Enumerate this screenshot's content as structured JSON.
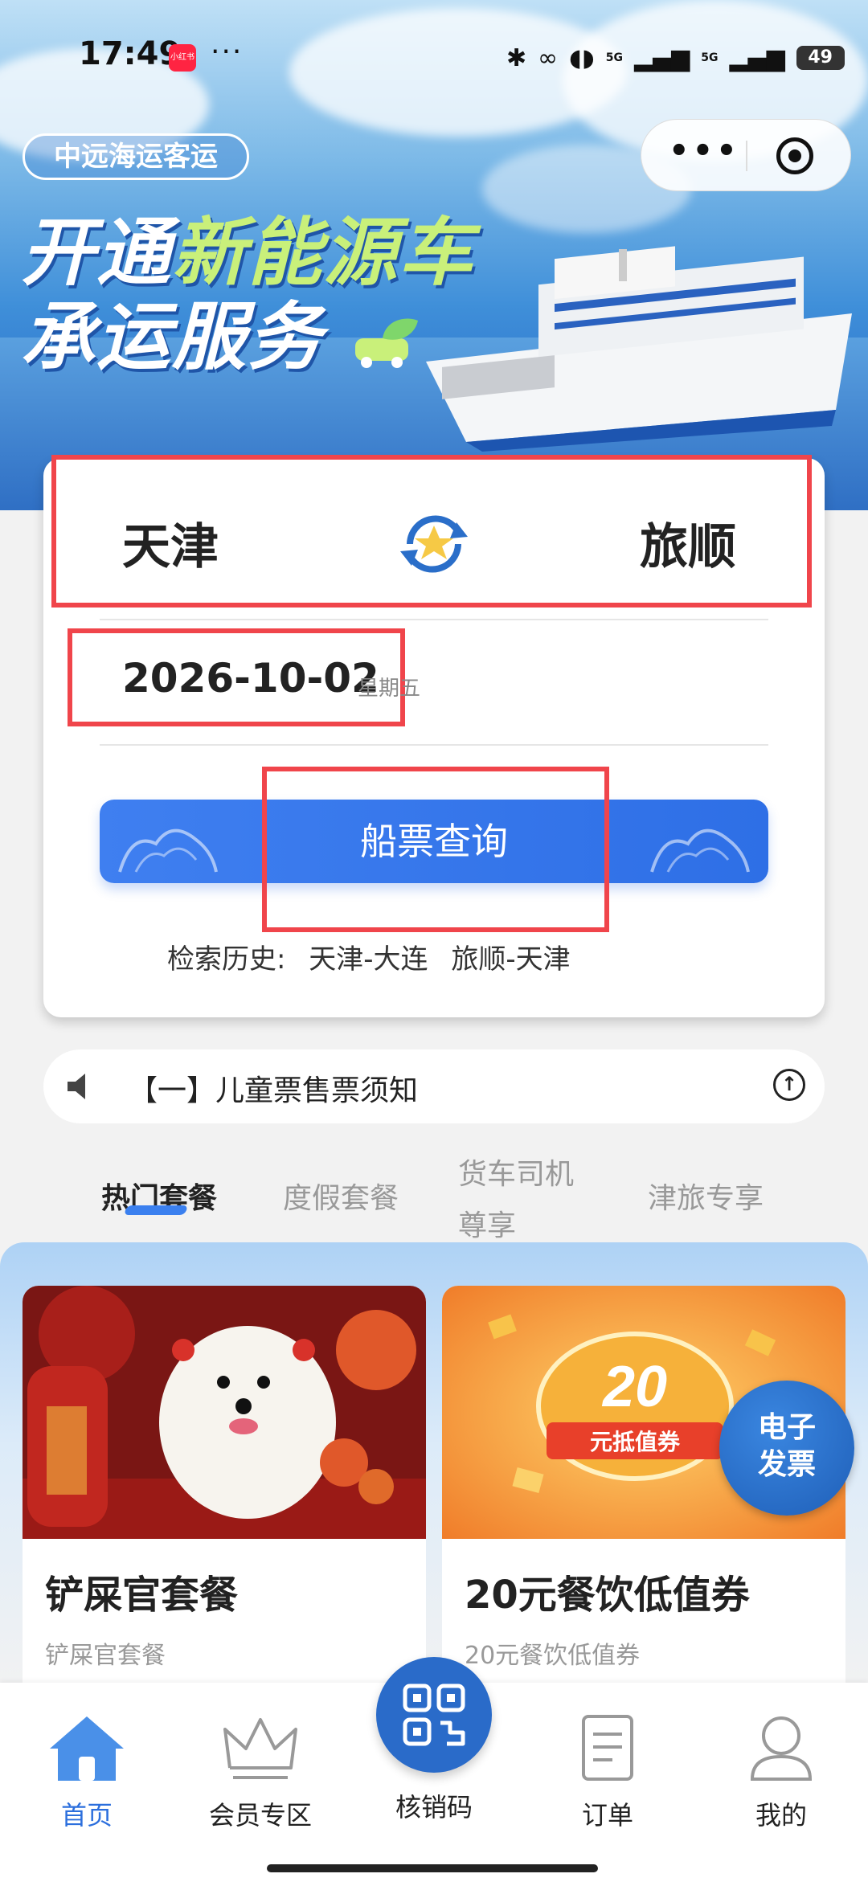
{
  "status_bar": {
    "time": "17:49",
    "app_badge": "小红书",
    "more": "···",
    "network1": "5G",
    "network2": "5G",
    "battery": "49"
  },
  "banner": {
    "brand": "中远海运客运",
    "headline_part1": "开通",
    "headline_part1_green": "新能源车",
    "headline_part2": "承运服务"
  },
  "search": {
    "from_city": "天津",
    "to_city": "旅顺",
    "date": "2026-10-02",
    "weekday": "星期五",
    "query_button": "船票查询",
    "history_label": "检索历史:",
    "history": [
      "天津-大连",
      "旅顺-天津"
    ]
  },
  "notice": {
    "text": "【一】儿童票售票须知"
  },
  "tabs": [
    {
      "label": "热门套餐",
      "active": true
    },
    {
      "label": "度假套餐",
      "active": false
    },
    {
      "label": "货车司机尊享",
      "active": false
    },
    {
      "label": "津旅专享",
      "active": false
    }
  ],
  "products": [
    {
      "title": "铲屎官套餐",
      "subtitle": "铲屎官套餐"
    },
    {
      "title": "20元餐饮低值券",
      "subtitle": "20元餐饮低值券",
      "voucher_amount": "20",
      "voucher_text": "元抵值券"
    }
  ],
  "floating": {
    "invoice_line1": "电子",
    "invoice_line2": "发票"
  },
  "bottom_nav": {
    "items": [
      {
        "label": "首页",
        "active": true
      },
      {
        "label": "会员专区",
        "active": false
      },
      {
        "label": "核销码",
        "active": false
      },
      {
        "label": "订单",
        "active": false
      },
      {
        "label": "我的",
        "active": false
      }
    ]
  },
  "colors": {
    "accent": "#3b80ef",
    "highlight": "#f0454b",
    "nav_active": "#2c6fdd"
  }
}
